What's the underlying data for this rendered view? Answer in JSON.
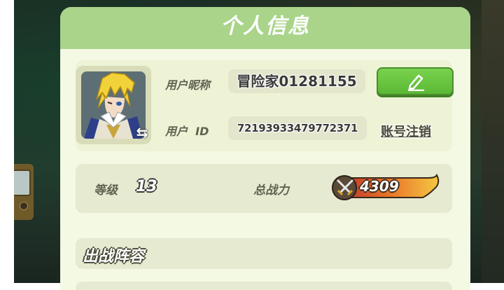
{
  "panel": {
    "title": "个人信息"
  },
  "profile": {
    "nickname_label": "用户昵称",
    "nickname_value": "冒险家01281155",
    "id_label": "用户  ID",
    "id_value": "72193933479772371",
    "cancel_account_label": "账号注销",
    "edit_icon": "pencil-edit-icon",
    "swap_icon": "switch-arrows-icon"
  },
  "stats": {
    "level_label": "等级",
    "level_value": "13",
    "power_label": "总战力",
    "power_value": "4309",
    "power_icon": "crossed-swords-icon"
  },
  "lineup": {
    "title": "出战阵容"
  },
  "colors": {
    "header": "#a9d48a",
    "panel": "#f4f9e4",
    "edit_button": "#5bb835",
    "power_badge_start": "#c0392b",
    "power_badge_end": "#f5c842"
  }
}
